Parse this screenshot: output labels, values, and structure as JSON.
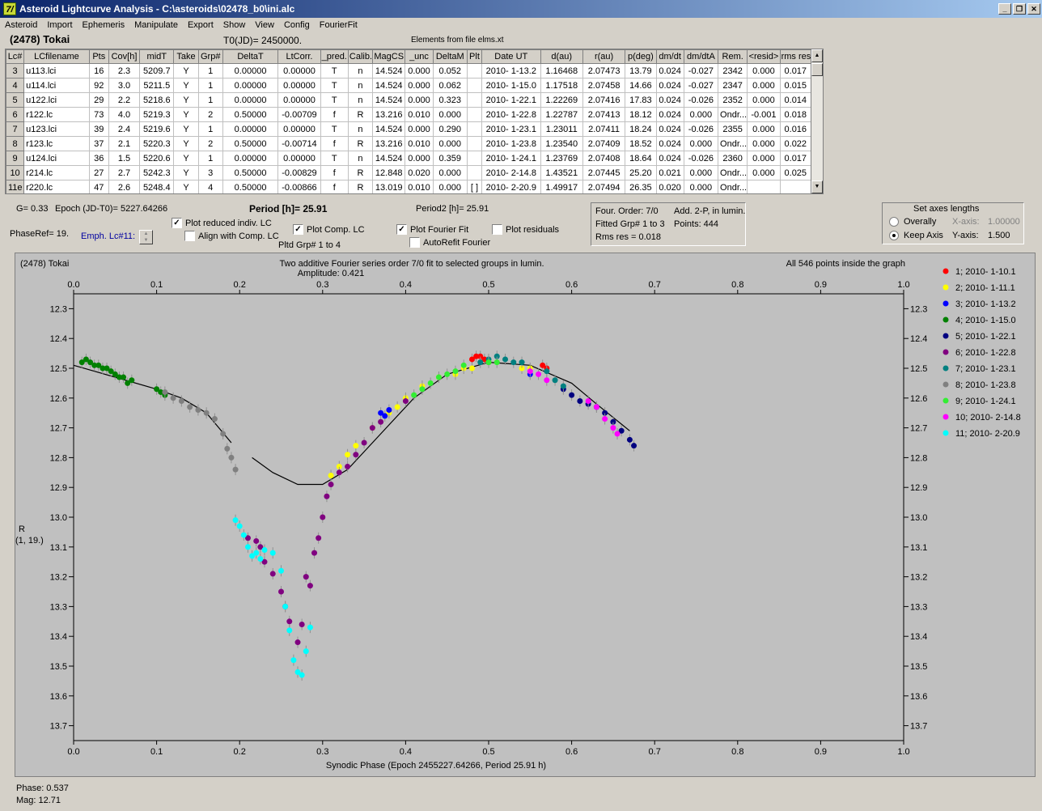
{
  "window": {
    "title": "Asteroid Lightcurve Analysis - C:\\asteroids\\02478_b0\\ini.alc",
    "icon_glyph": "7/",
    "min_label": "_",
    "restore_label": "❐",
    "close_label": "✕"
  },
  "menu": [
    "Asteroid",
    "Import",
    "Ephemeris",
    "Manipulate",
    "Export",
    "Show",
    "View",
    "Config",
    "FourierFit"
  ],
  "header": {
    "asteroid_name": "(2478) Tokai",
    "t0": "T0(JD)= 2450000.",
    "elements": "Elements from file elms.xt"
  },
  "table": {
    "columns": [
      "Lc#",
      "LCfilename",
      "Pts",
      "Cov[h]",
      "midT",
      "Take",
      "Grp#",
      "DeltaT",
      "LtCorr.",
      "_pred.",
      "Calib.",
      "MagCS",
      "_unc",
      "DeltaM",
      "Plt",
      "Date UT",
      "d(au)",
      "r(au)",
      "p(deg)",
      "dm/dt",
      "dm/dtA",
      "Rem.",
      "<resid>",
      "rms res"
    ],
    "rows": [
      [
        "3",
        "u113.lci",
        "16",
        "2.3",
        "5209.7",
        "Y",
        "1",
        "0.00000",
        "0.00000",
        "T",
        "n",
        "14.524",
        "0.000",
        "0.052",
        "",
        "2010- 1-13.2",
        "1.16468",
        "2.07473",
        "13.79",
        "0.024",
        "-0.027",
        "2342",
        "0.000",
        "0.017"
      ],
      [
        "4",
        "u114.lci",
        "92",
        "3.0",
        "5211.5",
        "Y",
        "1",
        "0.00000",
        "0.00000",
        "T",
        "n",
        "14.524",
        "0.000",
        "0.062",
        "",
        "2010- 1-15.0",
        "1.17518",
        "2.07458",
        "14.66",
        "0.024",
        "-0.027",
        "2347",
        "0.000",
        "0.015"
      ],
      [
        "5",
        "u122.lci",
        "29",
        "2.2",
        "5218.6",
        "Y",
        "1",
        "0.00000",
        "0.00000",
        "T",
        "n",
        "14.524",
        "0.000",
        "0.323",
        "",
        "2010- 1-22.1",
        "1.22269",
        "2.07416",
        "17.83",
        "0.024",
        "-0.026",
        "2352",
        "0.000",
        "0.014"
      ],
      [
        "6",
        "r122.lc",
        "73",
        "4.0",
        "5219.3",
        "Y",
        "2",
        "0.50000",
        "-0.00709",
        "f",
        "R",
        "13.216",
        "0.010",
        "0.000",
        "",
        "2010- 1-22.8",
        "1.22787",
        "2.07413",
        "18.12",
        "0.024",
        "0.000",
        "Ondr...",
        "-0.001",
        "0.018"
      ],
      [
        "7",
        "u123.lci",
        "39",
        "2.4",
        "5219.6",
        "Y",
        "1",
        "0.00000",
        "0.00000",
        "T",
        "n",
        "14.524",
        "0.000",
        "0.290",
        "",
        "2010- 1-23.1",
        "1.23011",
        "2.07411",
        "18.24",
        "0.024",
        "-0.026",
        "2355",
        "0.000",
        "0.016"
      ],
      [
        "8",
        "r123.lc",
        "37",
        "2.1",
        "5220.3",
        "Y",
        "2",
        "0.50000",
        "-0.00714",
        "f",
        "R",
        "13.216",
        "0.010",
        "0.000",
        "",
        "2010- 1-23.8",
        "1.23540",
        "2.07409",
        "18.52",
        "0.024",
        "0.000",
        "Ondr...",
        "0.000",
        "0.022"
      ],
      [
        "9",
        "u124.lci",
        "36",
        "1.5",
        "5220.6",
        "Y",
        "1",
        "0.00000",
        "0.00000",
        "T",
        "n",
        "14.524",
        "0.000",
        "0.359",
        "",
        "2010- 1-24.1",
        "1.23769",
        "2.07408",
        "18.64",
        "0.024",
        "-0.026",
        "2360",
        "0.000",
        "0.017"
      ],
      [
        "10",
        "r214.lc",
        "27",
        "2.7",
        "5242.3",
        "Y",
        "3",
        "0.50000",
        "-0.00829",
        "f",
        "R",
        "12.848",
        "0.020",
        "0.000",
        "",
        "2010- 2-14.8",
        "1.43521",
        "2.07445",
        "25.20",
        "0.021",
        "0.000",
        "Ondr...",
        "0.000",
        "0.025"
      ],
      [
        "11e",
        "r220.lc",
        "47",
        "2.6",
        "5248.4",
        "Y",
        "4",
        "0.50000",
        "-0.00866",
        "f",
        "R",
        "13.019",
        "0.010",
        "0.000",
        "[ ]",
        "2010- 2-20.9",
        "1.49917",
        "2.07494",
        "26.35",
        "0.020",
        "0.000",
        "Ondr...",
        "",
        ""
      ]
    ]
  },
  "params": {
    "g": "G= 0.33",
    "epoch": "Epoch (JD-T0)= 5227.64266",
    "period": "Period [h]= 25.91",
    "period2": "Period2 [h]= 25.91",
    "phaseref": "PhaseRef= 19.",
    "emph": "Emph. Lc#11:",
    "pltd_grp": "Pltd Grp#  1   to   4"
  },
  "checkboxes": {
    "plot_reduced": {
      "label": "Plot reduced indiv. LC",
      "checked": "✓"
    },
    "align_comp": {
      "label": "Align with Comp. LC",
      "checked": ""
    },
    "plot_comp": {
      "label": "Plot Comp. LC",
      "checked": "✓"
    },
    "plot_fourier": {
      "label": "Plot Fourier Fit",
      "checked": "✓"
    },
    "autorefit": {
      "label": "AutoRefit Fourier",
      "checked": ""
    },
    "plot_residuals": {
      "label": "Plot residuals",
      "checked": ""
    }
  },
  "fourier_panel": {
    "order": "Four. Order:  7/0",
    "add": "Add. 2-P, in lumin.",
    "fitted": "Fitted Grp# 1 to 3",
    "points": "Points: 444",
    "rms": "Rms res     = 0.018"
  },
  "axes_panel": {
    "title": "Set axes lengths",
    "overally": "Overally",
    "keep_axis": "Keep Axis",
    "xaxis_label": "X-axis:",
    "xaxis_value": "1.00000",
    "yaxis_label": "Y-axis:",
    "yaxis_value": "1.500"
  },
  "footer": {
    "phase": "Phase:  0.537",
    "mag": "Mag:    12.71"
  },
  "chart_data": {
    "type": "scatter",
    "corner_label": "(2478) Tokai",
    "title": "Two additive Fourier series order 7/0 fit to selected groups in lumin.",
    "subtitle": "Amplitude: 0.421",
    "note": "All 546 points inside the graph",
    "xlabel": "Synodic Phase (Epoch 2455227.64266, Period 25.91 h)",
    "ylabel": "R",
    "ylabel2": "(1, 19.)",
    "xlim": [
      0,
      1
    ],
    "ylim": [
      13.75,
      12.25
    ],
    "xticks": [
      "0.0",
      "0.1",
      "0.2",
      "0.3",
      "0.4",
      "0.5",
      "0.6",
      "0.7",
      "0.8",
      "0.9",
      "1.0"
    ],
    "yticks": [
      "12.3",
      "12.4",
      "12.5",
      "12.6",
      "12.7",
      "12.8",
      "12.9",
      "13.0",
      "13.1",
      "13.2",
      "13.3",
      "13.4",
      "13.5",
      "13.6",
      "13.7"
    ],
    "fit_curve": {
      "segment1": [
        [
          0.0,
          12.49
        ],
        [
          0.05,
          12.53
        ],
        [
          0.1,
          12.57
        ],
        [
          0.13,
          12.6
        ],
        [
          0.16,
          12.65
        ],
        [
          0.19,
          12.75
        ]
      ],
      "segment2": [
        [
          0.215,
          12.8
        ],
        [
          0.24,
          12.85
        ],
        [
          0.27,
          12.89
        ],
        [
          0.3,
          12.89
        ],
        [
          0.33,
          12.84
        ],
        [
          0.37,
          12.72
        ],
        [
          0.41,
          12.6
        ],
        [
          0.45,
          12.52
        ],
        [
          0.5,
          12.48
        ],
        [
          0.55,
          12.49
        ],
        [
          0.6,
          12.55
        ],
        [
          0.63,
          12.62
        ],
        [
          0.67,
          12.71
        ]
      ]
    },
    "series": [
      {
        "name": "1; 2010- 1-10.1",
        "color": "#ff0000",
        "points": [
          [
            0.48,
            12.47
          ],
          [
            0.485,
            12.46
          ],
          [
            0.49,
            12.46
          ],
          [
            0.495,
            12.47
          ],
          [
            0.5,
            12.48
          ],
          [
            0.565,
            12.49
          ],
          [
            0.57,
            12.5
          ]
        ]
      },
      {
        "name": "2; 2010- 1-11.1",
        "color": "#ffff00",
        "points": [
          [
            0.31,
            12.86
          ],
          [
            0.32,
            12.83
          ],
          [
            0.33,
            12.79
          ],
          [
            0.34,
            12.76
          ],
          [
            0.36,
            12.7
          ],
          [
            0.38,
            12.65
          ],
          [
            0.39,
            12.63
          ],
          [
            0.4,
            12.6
          ],
          [
            0.42,
            12.56
          ],
          [
            0.44,
            12.53
          ],
          [
            0.46,
            12.52
          ],
          [
            0.47,
            12.5
          ],
          [
            0.48,
            12.5
          ],
          [
            0.54,
            12.5
          ],
          [
            0.55,
            12.5
          ]
        ]
      },
      {
        "name": "3; 2010- 1-13.2",
        "color": "#0000ff",
        "points": [
          [
            0.37,
            12.65
          ],
          [
            0.375,
            12.66
          ],
          [
            0.38,
            12.64
          ],
          [
            0.55,
            12.52
          ]
        ]
      },
      {
        "name": "4; 2010- 1-15.0",
        "color": "#008000",
        "points": [
          [
            0.01,
            12.48
          ],
          [
            0.015,
            12.47
          ],
          [
            0.02,
            12.48
          ],
          [
            0.025,
            12.49
          ],
          [
            0.03,
            12.49
          ],
          [
            0.035,
            12.5
          ],
          [
            0.04,
            12.5
          ],
          [
            0.045,
            12.51
          ],
          [
            0.05,
            12.52
          ],
          [
            0.055,
            12.53
          ],
          [
            0.06,
            12.53
          ],
          [
            0.065,
            12.55
          ],
          [
            0.07,
            12.54
          ],
          [
            0.1,
            12.57
          ],
          [
            0.105,
            12.58
          ],
          [
            0.11,
            12.59
          ]
        ]
      },
      {
        "name": "5; 2010- 1-22.1",
        "color": "#000080",
        "points": [
          [
            0.59,
            12.57
          ],
          [
            0.6,
            12.59
          ],
          [
            0.61,
            12.61
          ],
          [
            0.62,
            12.62
          ],
          [
            0.63,
            12.63
          ],
          [
            0.64,
            12.65
          ],
          [
            0.65,
            12.68
          ],
          [
            0.66,
            12.71
          ],
          [
            0.67,
            12.74
          ],
          [
            0.675,
            12.76
          ]
        ]
      },
      {
        "name": "6; 2010- 1-22.8",
        "color": "#800080",
        "points": [
          [
            0.21,
            13.07
          ],
          [
            0.22,
            13.08
          ],
          [
            0.225,
            13.1
          ],
          [
            0.23,
            13.15
          ],
          [
            0.24,
            13.19
          ],
          [
            0.25,
            13.25
          ],
          [
            0.255,
            13.3
          ],
          [
            0.26,
            13.35
          ],
          [
            0.27,
            13.42
          ],
          [
            0.275,
            13.36
          ],
          [
            0.28,
            13.2
          ],
          [
            0.285,
            13.23
          ],
          [
            0.29,
            13.12
          ],
          [
            0.295,
            13.07
          ],
          [
            0.3,
            13.0
          ],
          [
            0.305,
            12.93
          ],
          [
            0.31,
            12.89
          ],
          [
            0.32,
            12.85
          ],
          [
            0.33,
            12.83
          ],
          [
            0.34,
            12.79
          ],
          [
            0.35,
            12.75
          ],
          [
            0.36,
            12.7
          ],
          [
            0.37,
            12.68
          ],
          [
            0.4,
            12.61
          ]
        ]
      },
      {
        "name": "7; 2010- 1-23.1",
        "color": "#008080",
        "points": [
          [
            0.49,
            12.48
          ],
          [
            0.5,
            12.47
          ],
          [
            0.51,
            12.46
          ],
          [
            0.52,
            12.47
          ],
          [
            0.53,
            12.48
          ],
          [
            0.54,
            12.48
          ],
          [
            0.57,
            12.51
          ],
          [
            0.58,
            12.54
          ],
          [
            0.59,
            12.56
          ]
        ]
      },
      {
        "name": "8; 2010- 1-23.8",
        "color": "#808080",
        "points": [
          [
            0.11,
            12.58
          ],
          [
            0.12,
            12.6
          ],
          [
            0.13,
            12.61
          ],
          [
            0.14,
            12.63
          ],
          [
            0.15,
            12.64
          ],
          [
            0.16,
            12.65
          ],
          [
            0.17,
            12.67
          ],
          [
            0.18,
            12.72
          ],
          [
            0.185,
            12.77
          ],
          [
            0.19,
            12.8
          ],
          [
            0.195,
            12.84
          ]
        ]
      },
      {
        "name": "9; 2010- 1-24.1",
        "color": "#33ee33",
        "points": [
          [
            0.41,
            12.59
          ],
          [
            0.42,
            12.57
          ],
          [
            0.43,
            12.55
          ],
          [
            0.44,
            12.53
          ],
          [
            0.45,
            12.52
          ],
          [
            0.46,
            12.51
          ],
          [
            0.47,
            12.49
          ],
          [
            0.5,
            12.48
          ],
          [
            0.51,
            12.48
          ]
        ]
      },
      {
        "name": "10; 2010- 2-14.8",
        "color": "#ff00ff",
        "points": [
          [
            0.55,
            12.51
          ],
          [
            0.56,
            12.52
          ],
          [
            0.57,
            12.54
          ],
          [
            0.62,
            12.61
          ],
          [
            0.63,
            12.63
          ],
          [
            0.64,
            12.67
          ],
          [
            0.65,
            12.7
          ],
          [
            0.655,
            12.72
          ]
        ]
      },
      {
        "name": "11; 2010- 2-20.9",
        "color": "#00ffff",
        "points": [
          [
            0.195,
            13.01
          ],
          [
            0.2,
            13.03
          ],
          [
            0.205,
            13.06
          ],
          [
            0.21,
            13.1
          ],
          [
            0.215,
            13.13
          ],
          [
            0.22,
            13.12
          ],
          [
            0.225,
            13.14
          ],
          [
            0.23,
            13.11
          ],
          [
            0.24,
            13.12
          ],
          [
            0.25,
            13.18
          ],
          [
            0.255,
            13.3
          ],
          [
            0.26,
            13.38
          ],
          [
            0.265,
            13.48
          ],
          [
            0.27,
            13.52
          ],
          [
            0.275,
            13.53
          ],
          [
            0.28,
            13.45
          ],
          [
            0.285,
            13.37
          ]
        ]
      }
    ],
    "legend_position": "right"
  }
}
